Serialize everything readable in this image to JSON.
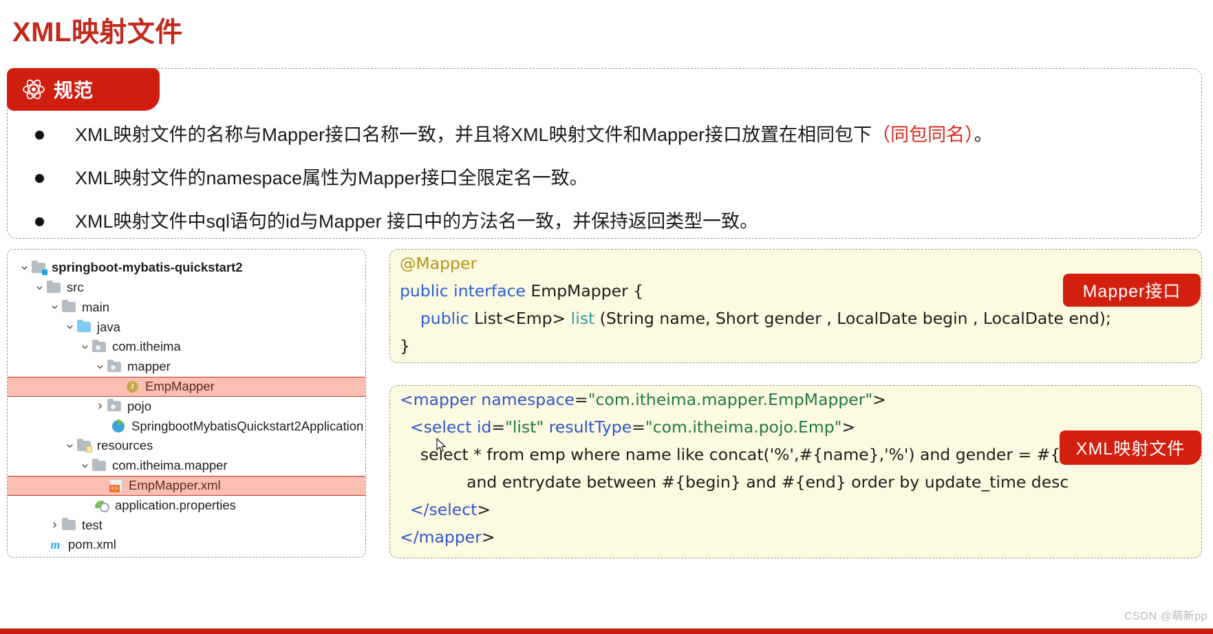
{
  "slide": {
    "title": "XML映射文件",
    "accent_color": "#c3291c",
    "badge_color": "#cf1d10"
  },
  "rules": {
    "badge_icon": "atom-icon",
    "badge_label": "规范",
    "items": [
      {
        "text_before": "XML映射文件的名称与Mapper接口名称一致，并且将XML映射文件和Mapper接口放置在相同包下",
        "highlight": "（同包同名）",
        "text_after": "。"
      },
      {
        "text_before": "XML映射文件的namespace属性为Mapper接口全限定名一致。",
        "highlight": "",
        "text_after": ""
      },
      {
        "text_before": "XML映射文件中sql语句的id与Mapper 接口中的方法名一致，并保持返回类型一致。",
        "highlight": "",
        "text_after": ""
      }
    ]
  },
  "tree": {
    "nodes": [
      {
        "label": "springboot-mybatis-quickstart2",
        "indent": 0,
        "chevron": "down",
        "icon": "folder-module-icon",
        "bold": true,
        "highlight": false
      },
      {
        "label": "src",
        "indent": 1,
        "chevron": "down",
        "icon": "folder-icon",
        "bold": false,
        "highlight": false
      },
      {
        "label": "main",
        "indent": 2,
        "chevron": "down",
        "icon": "folder-icon",
        "bold": false,
        "highlight": false
      },
      {
        "label": "java",
        "indent": 3,
        "chevron": "down",
        "icon": "folder-source-icon",
        "bold": false,
        "highlight": false
      },
      {
        "label": "com.itheima",
        "indent": 4,
        "chevron": "down",
        "icon": "folder-package-icon",
        "bold": false,
        "highlight": false
      },
      {
        "label": "mapper",
        "indent": 5,
        "chevron": "down",
        "icon": "folder-package-icon",
        "bold": false,
        "highlight": false
      },
      {
        "label": "EmpMapper",
        "indent": 6,
        "chevron": "none",
        "icon": "interface-icon",
        "bold": false,
        "highlight": true
      },
      {
        "label": "pojo",
        "indent": 5,
        "chevron": "right",
        "icon": "folder-package-icon",
        "bold": false,
        "highlight": false
      },
      {
        "label": "SpringbootMybatisQuickstart2Application",
        "indent": 6,
        "chevron": "none",
        "icon": "spring-class-icon",
        "bold": false,
        "highlight": false
      },
      {
        "label": "resources",
        "indent": 3,
        "chevron": "down",
        "icon": "folder-resources-icon",
        "bold": false,
        "highlight": false
      },
      {
        "label": "com.itheima.mapper",
        "indent": 4,
        "chevron": "down",
        "icon": "folder-icon",
        "bold": false,
        "highlight": false
      },
      {
        "label": "EmpMapper.xml",
        "indent": 5,
        "chevron": "none",
        "icon": "xml-file-icon",
        "bold": false,
        "highlight": true
      },
      {
        "label": "application.properties",
        "indent": 5,
        "chevron": "none",
        "icon": "properties-file-icon",
        "bold": false,
        "highlight": false
      },
      {
        "label": "test",
        "indent": 2,
        "chevron": "right",
        "icon": "folder-icon",
        "bold": false,
        "highlight": false
      },
      {
        "label": "pom.xml",
        "indent": 1,
        "chevron": "none",
        "icon": "maven-icon",
        "bold": false,
        "highlight": false
      }
    ]
  },
  "java_panel": {
    "tag_label": "Mapper接口",
    "line1_annotation": "@Mapper",
    "line2_k1": "public interface",
    "line2_rest": " EmpMapper {",
    "line3_indent": "    ",
    "line3_k1": "public",
    "line3_t1": " List<Emp> ",
    "line3_m": "list",
    "line3_rest": " (String name, Short gender , LocalDate begin , LocalDate end);",
    "line4": "}"
  },
  "xml_panel": {
    "tag_label": "XML映射文件",
    "line1": {
      "tag_open": "<mapper ",
      "attr": "namespace",
      "eq": "=",
      "value": "\"com.itheima.mapper.EmpMapper\"",
      "tag_close": ">"
    },
    "line2": {
      "indent": "  ",
      "tag_open": "<select ",
      "attr1": "id",
      "eq1": "=",
      "value1": "\"list\"",
      "sp": " ",
      "attr2": "resultType",
      "eq2": "=",
      "value2": "\"com.itheima.pojo.Emp\"",
      "tag_close": ">"
    },
    "line3": "    select * from emp where name like concat('%',#{name},'%') and gender = #{gender}",
    "line4": "             and entrydate between #{begin} and #{end} order by update_time desc",
    "line5": {
      "indent": "  ",
      "tag": "</select",
      "tag_close": ">"
    },
    "line6": {
      "indent": "",
      "tag": "</mapper",
      "tag_close": ">"
    }
  },
  "watermark": "CSDN @萌新pp"
}
